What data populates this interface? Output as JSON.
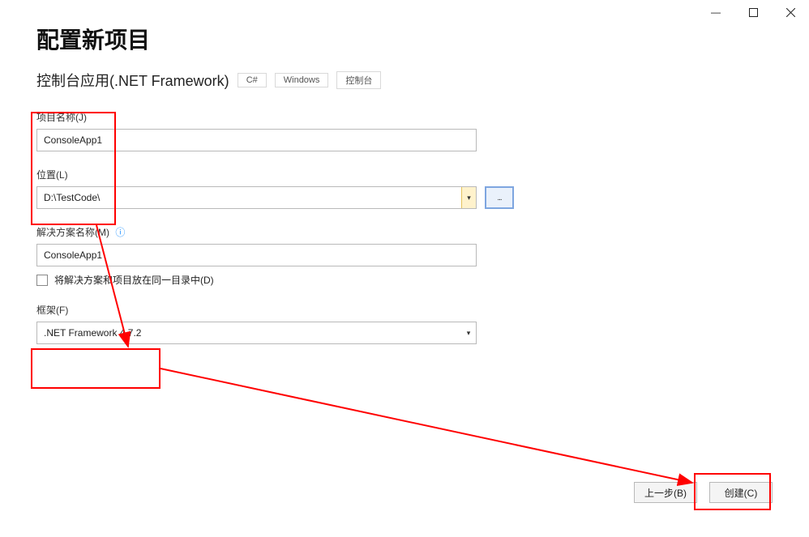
{
  "titlebar": {
    "minimize": "—",
    "maximize": "□",
    "close": "✕"
  },
  "page_title": "配置新项目",
  "subtitle": "控制台应用(.NET Framework)",
  "tags": [
    "C#",
    "Windows",
    "控制台"
  ],
  "project_name": {
    "label": "项目名称(J)",
    "value": "ConsoleApp1"
  },
  "location": {
    "label": "位置(L)",
    "value": "D:\\TestCode\\",
    "browse": "..."
  },
  "solution_name": {
    "label": "解决方案名称(M)",
    "value": "ConsoleApp1"
  },
  "checkbox": {
    "label": "将解决方案和项目放在同一目录中(D)"
  },
  "framework": {
    "label": "框架(F)",
    "value": ".NET Framework 4.7.2"
  },
  "buttons": {
    "back": "上一步(B)",
    "create": "创建(C)"
  }
}
